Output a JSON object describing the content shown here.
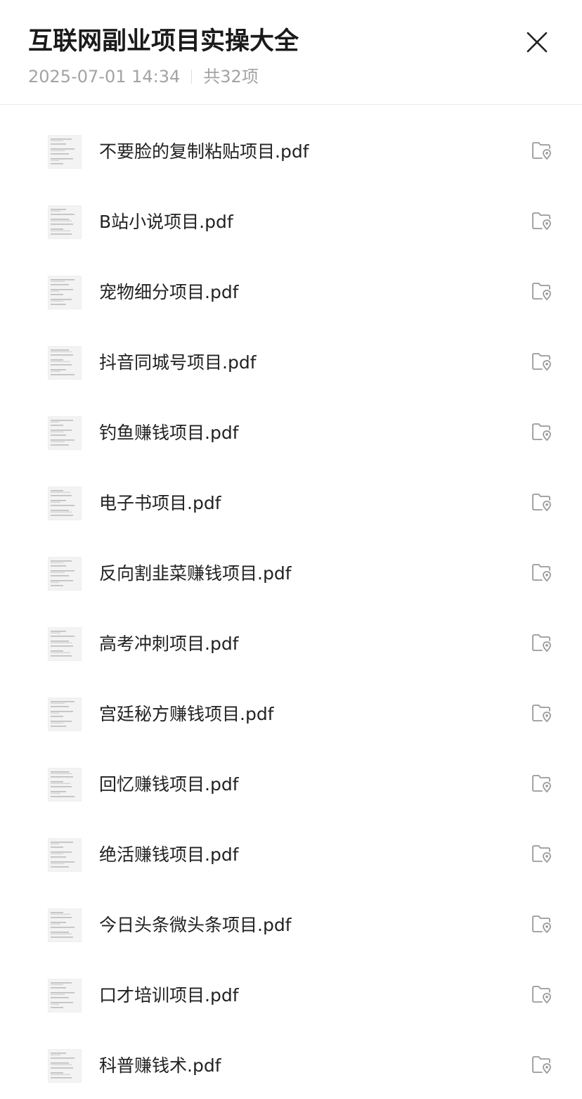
{
  "header": {
    "title": "互联网副业项目实操大全",
    "datetime": "2025-07-01 14:34",
    "count_label": "共32项",
    "close_icon": "close-icon"
  },
  "colors": {
    "title": "#1a1a1a",
    "meta": "#a3a3a3",
    "filename": "#222222",
    "icon": "#9a9a9a",
    "divider": "#ececec"
  },
  "files": [
    {
      "name": "不要脸的复制粘贴项目.pdf"
    },
    {
      "name": "B站小说项目.pdf"
    },
    {
      "name": "宠物细分项目.pdf"
    },
    {
      "name": "抖音同城号项目.pdf"
    },
    {
      "name": "钓鱼赚钱项目.pdf"
    },
    {
      "name": "电子书项目.pdf"
    },
    {
      "name": "反向割韭菜赚钱项目.pdf"
    },
    {
      "name": "高考冲刺项目.pdf"
    },
    {
      "name": "宫廷秘方赚钱项目.pdf"
    },
    {
      "name": "回忆赚钱项目.pdf"
    },
    {
      "name": "绝活赚钱项目.pdf"
    },
    {
      "name": "今日头条微头条项目.pdf"
    },
    {
      "name": "口才培训项目.pdf"
    },
    {
      "name": "科普赚钱术.pdf"
    }
  ],
  "row_icons": {
    "thumbnail": "pdf-thumbnail",
    "action": "folder-location-icon"
  }
}
